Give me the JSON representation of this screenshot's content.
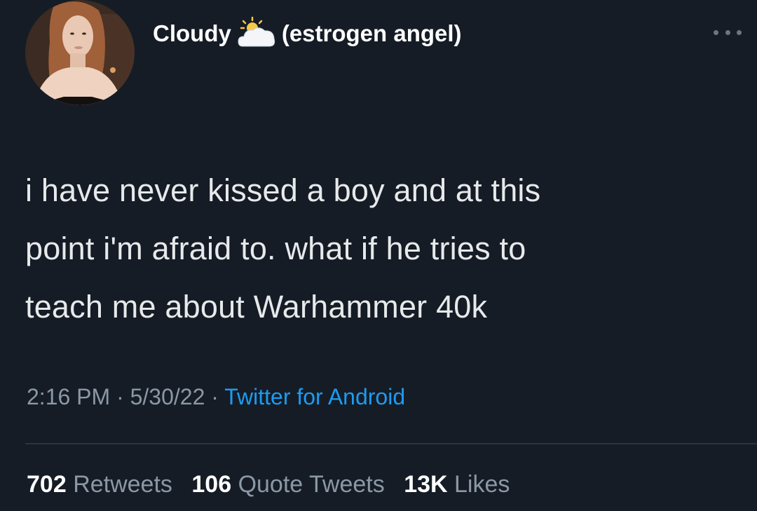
{
  "user": {
    "name_main": "Cloudy",
    "name_suffix": "(estrogen angel)",
    "emoji": "sun-behind-cloud-icon"
  },
  "tweet": {
    "lines": [
      "i have never kissed a boy and at this",
      "point i'm afraid to. what if he tries to",
      "teach me about Warhammer 40k"
    ],
    "time": "2:16 PM",
    "date": "5/30/22",
    "separator": "·",
    "source": "Twitter for Android"
  },
  "stats": {
    "retweets_count": "702",
    "retweets_label": "Retweets",
    "quotes_count": "106",
    "quotes_label": "Quote Tweets",
    "likes_count": "13K",
    "likes_label": "Likes"
  },
  "colors": {
    "background": "#151c26",
    "text": "#e7e9ea",
    "muted": "#8b98a5",
    "link": "#1d9bf0",
    "divider": "#2f3336"
  }
}
